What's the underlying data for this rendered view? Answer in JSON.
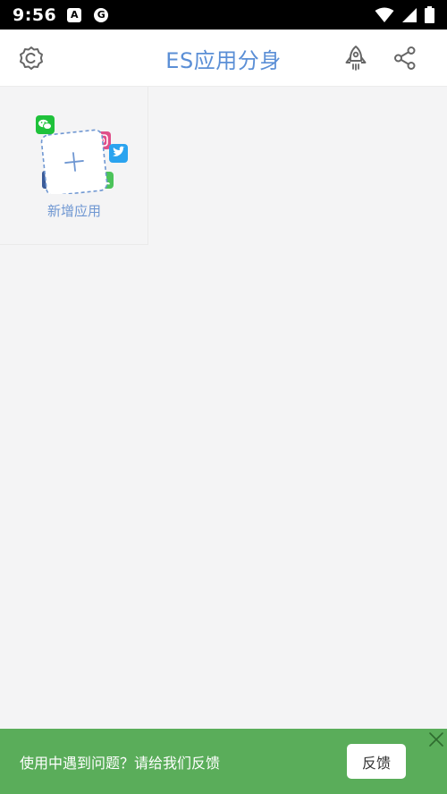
{
  "status_bar": {
    "time": "9:56",
    "notification_icons": [
      "A",
      "G"
    ],
    "indicators": [
      "wifi-icon",
      "signal-icon",
      "battery-icon"
    ]
  },
  "app_bar": {
    "title": "ES应用分身",
    "left_icon": "app-settings-icon",
    "right_icons": [
      "rocket-icon",
      "share-icon"
    ],
    "accent": "#5b8fd6"
  },
  "apps": [
    {
      "label": "新增应用",
      "icon": "add-app-icon",
      "decorations": [
        "wechat-icon",
        "instagram-icon",
        "twitter-icon",
        "facebook-icon",
        "phone-icon"
      ]
    }
  ],
  "feedback": {
    "message": "使用中遇到问题？请给我们反馈",
    "button_label": "反馈",
    "background": "#5aad5a"
  }
}
